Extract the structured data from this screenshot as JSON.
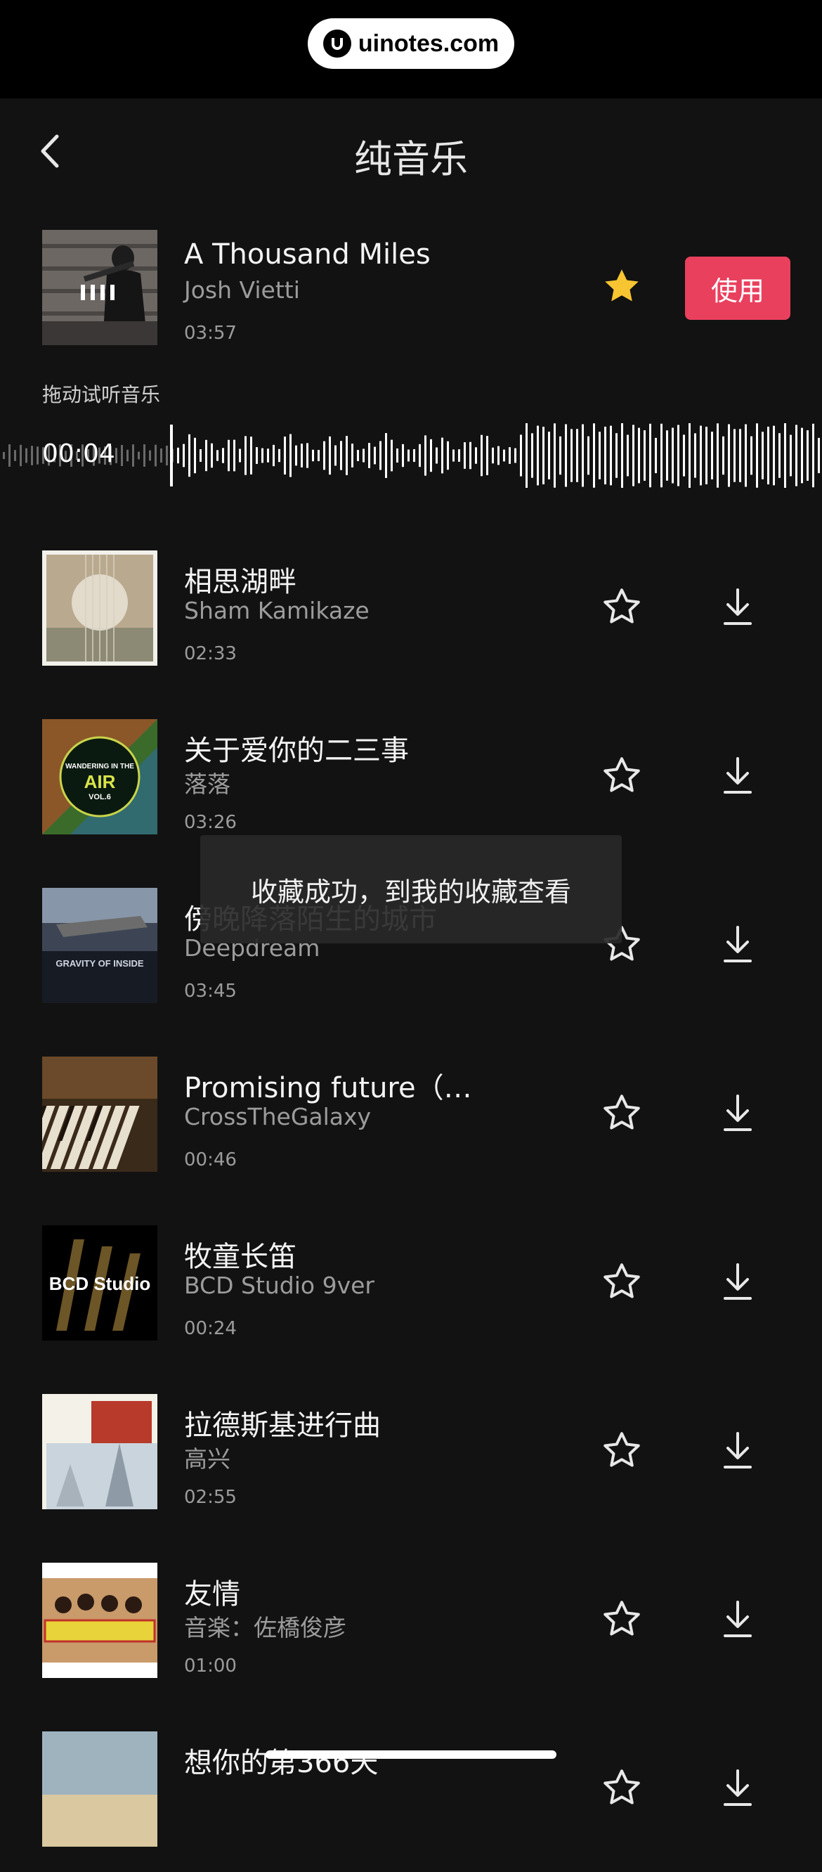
{
  "watermark": "uinotes.com",
  "header": {
    "title": "纯音乐"
  },
  "current": {
    "name": "A Thousand Miles",
    "artist": "Josh Vietti",
    "duration": "03:57",
    "use_label": "使用",
    "favorited": true
  },
  "preview": {
    "hint": "拖动试听音乐",
    "position": "00:04"
  },
  "toast": "收藏成功，到我的收藏查看",
  "tracks": [
    {
      "name": "相思湖畔",
      "artist": "Sham Kamikaze",
      "duration": "02:33"
    },
    {
      "name": "关于爱你的二三事",
      "artist": "落落",
      "duration": "03:26"
    },
    {
      "name": "傍晚降落陌生的城市",
      "artist": "Deepdream",
      "duration": "03:45"
    },
    {
      "name": "Promising future（…",
      "artist": "CrossTheGalaxy",
      "duration": "00:46"
    },
    {
      "name": "牧童长笛",
      "artist": "BCD Studio 9ver",
      "duration": "00:24"
    },
    {
      "name": "拉德斯基进行曲",
      "artist": "高兴",
      "duration": "02:55"
    },
    {
      "name": "友情",
      "artist": "音楽：佐橋俊彦",
      "duration": "01:00"
    },
    {
      "name": "想你的第366天",
      "artist": "",
      "duration": ""
    }
  ],
  "covers": {
    "c1_text": "WANDERING IN THE",
    "c1_big": "AIR",
    "c1_sub": "VOL.6",
    "c2_text": "GRAVITY OF INSIDE",
    "c4_text": "BCD Studio"
  },
  "colors": {
    "accent": "#e9405e",
    "star_active": "#f7c531",
    "bg": "#121212"
  }
}
